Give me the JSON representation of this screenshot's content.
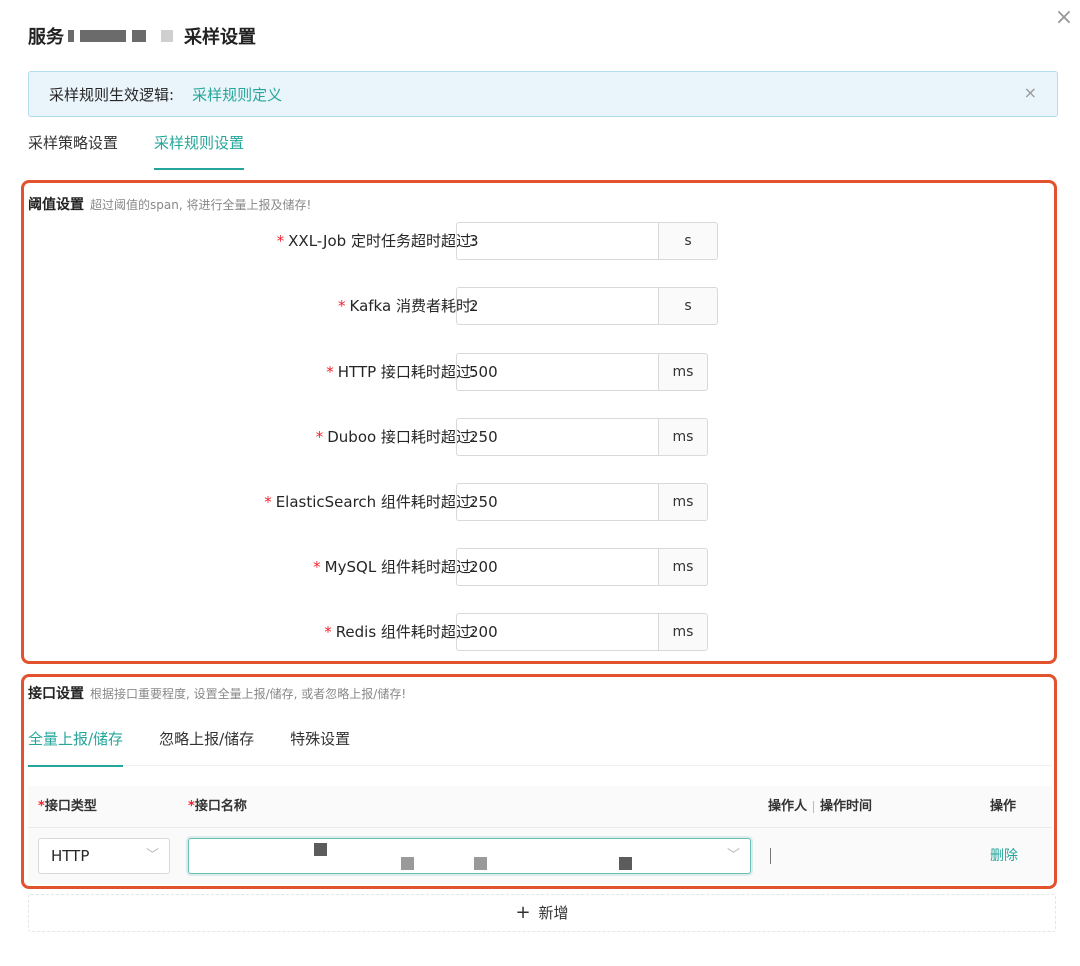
{
  "dialog": {
    "title_prefix": "服务",
    "title_suffix": "采样设置",
    "close_glyph": "×"
  },
  "notice": {
    "label": "采样规则生效逻辑:",
    "link": "采样规则定义",
    "close_glyph": "×"
  },
  "tabs": [
    {
      "label": "采样策略设置",
      "active": false
    },
    {
      "label": "采样规则设置",
      "active": true
    }
  ],
  "threshold": {
    "title": "阈值设置",
    "desc": "超过阈值的span, 将进行全量上报及储存!",
    "required_mark": "*",
    "rows": [
      {
        "label": "XXL-Job 定时任务超时超过:",
        "value": "3",
        "unit": "s"
      },
      {
        "label": "Kafka 消费者耗时:",
        "value": "2",
        "unit": "s"
      },
      {
        "label": "HTTP 接口耗时超过:",
        "value": "500",
        "unit": "ms"
      },
      {
        "label": "Duboo 接口耗时超过:",
        "value": "250",
        "unit": "ms"
      },
      {
        "label": "ElasticSearch 组件耗时超过:",
        "value": "250",
        "unit": "ms"
      },
      {
        "label": "MySQL 组件耗时超过:",
        "value": "200",
        "unit": "ms"
      },
      {
        "label": "Redis 组件耗时超过:",
        "value": "200",
        "unit": "ms"
      }
    ]
  },
  "interface": {
    "title": "接口设置",
    "desc": "根据接口重要程度, 设置全量上报/储存, 或者忽略上报/储存!",
    "subtabs": [
      {
        "label": "全量上报/储存",
        "active": true
      },
      {
        "label": "忽略上报/储存",
        "active": false
      },
      {
        "label": "特殊设置",
        "active": false
      }
    ],
    "table": {
      "required_mark": "*",
      "col_type": "接口类型",
      "col_name": "接口名称",
      "col_operator": "操作人",
      "col_time": "操作时间",
      "col_action": "操作",
      "row": {
        "type": "HTTP",
        "name": "",
        "operator": "",
        "action": "删除"
      }
    },
    "add_label": "新增",
    "add_glyph": "+"
  },
  "icons": {
    "chevron": "chevron-down-icon",
    "close": "close-icon",
    "plus": "plus-icon"
  },
  "colors": {
    "accent": "#26a69a",
    "highlight_border": "#e2522d",
    "required": "#f5222d",
    "notice_bg": "#eaf5fb"
  }
}
